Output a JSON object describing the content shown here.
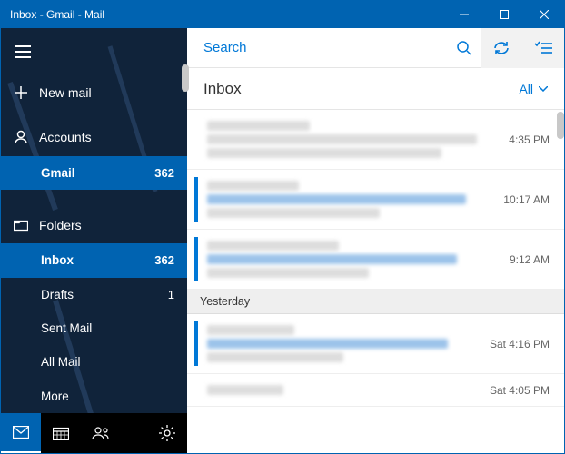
{
  "window": {
    "title": "Inbox - Gmail - Mail"
  },
  "sidebar": {
    "newMail": "New mail",
    "accounts": "Accounts",
    "accountItems": [
      {
        "label": "Gmail",
        "count": "362"
      }
    ],
    "foldersHeading": "Folders",
    "folders": [
      {
        "label": "Inbox",
        "count": "362",
        "selected": true
      },
      {
        "label": "Drafts",
        "count": "1"
      },
      {
        "label": "Sent Mail",
        "count": ""
      },
      {
        "label": "All Mail",
        "count": ""
      },
      {
        "label": "More",
        "count": ""
      }
    ]
  },
  "search": {
    "placeholder": "Search"
  },
  "header": {
    "title": "Inbox",
    "filter": "All"
  },
  "groups": {
    "yesterday": "Yesterday"
  },
  "messages": [
    {
      "time": "4:35 PM",
      "unread": false
    },
    {
      "time": "10:17 AM",
      "unread": true
    },
    {
      "time": "9:12 AM",
      "unread": true
    },
    {
      "time": "Sat 4:16 PM",
      "unread": true
    },
    {
      "time": "Sat 4:05 PM",
      "unread": false
    }
  ]
}
